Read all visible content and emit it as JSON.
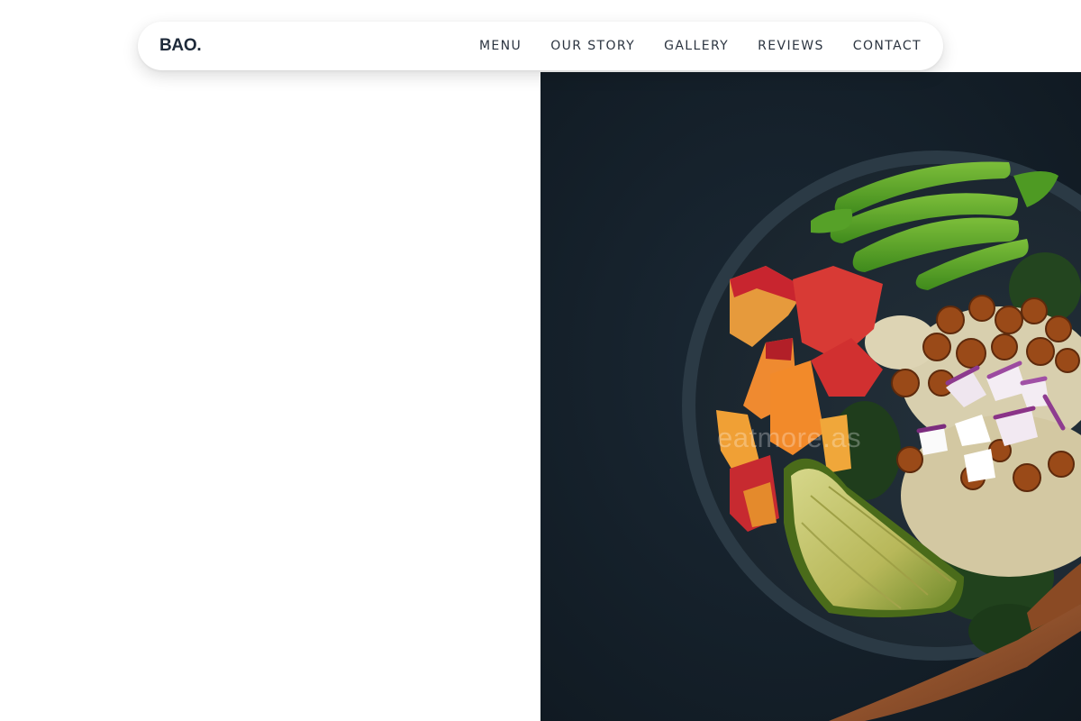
{
  "brand": {
    "name": "BAO."
  },
  "nav": {
    "items": [
      {
        "label": "MENU"
      },
      {
        "label": "OUR STORY"
      },
      {
        "label": "GALLERY"
      },
      {
        "label": "REVIEWS"
      },
      {
        "label": "CONTACT"
      }
    ]
  },
  "hero": {
    "image_subject": "bowl-of-salad-photo",
    "watermark": "eatmore.as"
  },
  "colors": {
    "brand_text": "#1e2a3a",
    "nav_text": "#2b3440",
    "photo_background": "#14202a"
  }
}
